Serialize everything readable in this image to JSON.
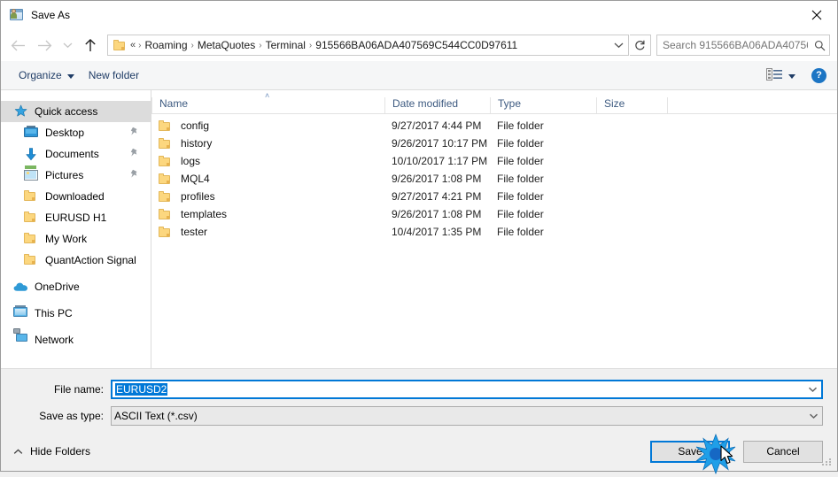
{
  "window": {
    "title": "Save As",
    "title_icon": "save-as-icon",
    "close_icon": "close-icon"
  },
  "nav": {
    "back_icon": "back-arrow-icon",
    "forward_icon": "forward-arrow-icon",
    "recent_icon": "chevron-down-icon",
    "up_icon": "up-arrow-icon",
    "refresh_icon": "refresh-icon",
    "address_caret_icon": "chevron-down-icon",
    "folder_icon": "folder-icon",
    "breadcrumb_prefix": "«",
    "breadcrumbs": [
      "Roaming",
      "MetaQuotes",
      "Terminal",
      "915566BA06ADA407569C544CC0D97611"
    ],
    "separator": "›"
  },
  "search": {
    "placeholder": "Search 915566BA06ADA40756...",
    "value": "",
    "icon": "search-icon"
  },
  "commandbar": {
    "organize_label": "Organize",
    "organize_caret_icon": "caret-down-icon",
    "new_folder_label": "New folder",
    "view_icon": "view-mode-icon",
    "view_caret_icon": "caret-down-icon",
    "help_label": "?",
    "help_icon": "help-icon"
  },
  "sidebar": {
    "items": [
      {
        "label": "Quick access",
        "icon": "star-icon",
        "selected": true,
        "indent": false,
        "group": true,
        "pinned": false
      },
      {
        "label": "Desktop",
        "icon": "desktop-icon",
        "selected": false,
        "indent": true,
        "group": false,
        "pinned": true
      },
      {
        "label": "Documents",
        "icon": "documents-icon",
        "selected": false,
        "indent": true,
        "group": false,
        "pinned": true
      },
      {
        "label": "Pictures",
        "icon": "pictures-icon",
        "selected": false,
        "indent": true,
        "group": false,
        "pinned": true
      },
      {
        "label": "Downloaded",
        "icon": "folder-icon",
        "selected": false,
        "indent": true,
        "group": false,
        "pinned": false
      },
      {
        "label": "EURUSD H1",
        "icon": "folder-icon",
        "selected": false,
        "indent": true,
        "group": false,
        "pinned": false
      },
      {
        "label": "My Work",
        "icon": "folder-icon",
        "selected": false,
        "indent": true,
        "group": false,
        "pinned": false
      },
      {
        "label": "QuantAction Signal",
        "icon": "folder-icon",
        "selected": false,
        "indent": true,
        "group": false,
        "pinned": false
      },
      {
        "label": "OneDrive",
        "icon": "onedrive-icon",
        "selected": false,
        "indent": false,
        "group": true,
        "pinned": false
      },
      {
        "label": "This PC",
        "icon": "this-pc-icon",
        "selected": false,
        "indent": false,
        "group": true,
        "pinned": false
      },
      {
        "label": "Network",
        "icon": "network-icon",
        "selected": false,
        "indent": false,
        "group": true,
        "pinned": false
      }
    ]
  },
  "filelist": {
    "columns": [
      "Name",
      "Date modified",
      "Type",
      "Size"
    ],
    "sort_indicator": "˄",
    "rows": [
      {
        "name": "config",
        "date": "9/27/2017 4:44 PM",
        "type": "File folder",
        "size": ""
      },
      {
        "name": "history",
        "date": "9/26/2017 10:17 PM",
        "type": "File folder",
        "size": ""
      },
      {
        "name": "logs",
        "date": "10/10/2017 1:17 PM",
        "type": "File folder",
        "size": ""
      },
      {
        "name": "MQL4",
        "date": "9/26/2017 1:08 PM",
        "type": "File folder",
        "size": ""
      },
      {
        "name": "profiles",
        "date": "9/27/2017 4:21 PM",
        "type": "File folder",
        "size": ""
      },
      {
        "name": "templates",
        "date": "9/26/2017 1:08 PM",
        "type": "File folder",
        "size": ""
      },
      {
        "name": "tester",
        "date": "10/4/2017 1:35 PM",
        "type": "File folder",
        "size": ""
      }
    ]
  },
  "form": {
    "filename_label": "File name:",
    "filename_value": "EURUSD2",
    "filetype_label": "Save as type:",
    "filetype_value": "ASCII Text (*.csv)",
    "caret_icon": "chevron-down-icon"
  },
  "footer": {
    "hide_folders_label": "Hide Folders",
    "hide_folders_icon": "chevron-up-icon",
    "save_label": "Save",
    "cancel_label": "Cancel",
    "resize_grip_icon": "resize-grip-icon",
    "cursor_icon": "mouse-cursor-icon",
    "click_effect_icon": "click-burst-icon"
  },
  "colors": {
    "accent": "#0078d7",
    "folder": "#fcd77f",
    "selection": "#dcdcdc",
    "help_blue": "#1c75c4"
  }
}
